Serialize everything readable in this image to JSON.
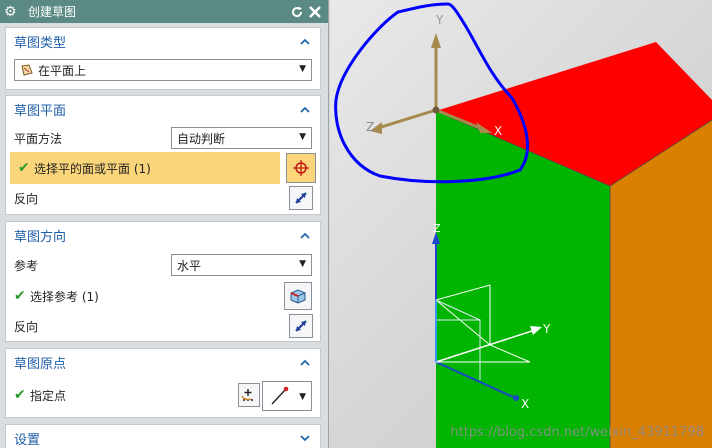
{
  "dialog": {
    "title": "创建草图",
    "icons": {
      "app": "gear-icon",
      "reset": "reset-icon",
      "close": "close-icon"
    }
  },
  "sketch_type": {
    "header": "草图类型",
    "value": "在平面上"
  },
  "sketch_plane": {
    "header": "草图平面",
    "method_label": "平面方法",
    "method_value": "自动判断",
    "select_label": "选择平的面或平面 (1)",
    "reverse_label": "反向"
  },
  "sketch_orientation": {
    "header": "草图方向",
    "reference_label": "参考",
    "reference_value": "水平",
    "select_label": "选择参考 (1)",
    "reverse_label": "反向"
  },
  "sketch_origin": {
    "header": "草图原点",
    "point_label": "指定点"
  },
  "settings": {
    "header": "设置"
  },
  "viewport": {
    "axis_labels": {
      "y_top": "Y",
      "x_top": "X",
      "z_top": "Z",
      "z_bottom": "Z",
      "y_bottom": "Y",
      "x_bottom": "X"
    },
    "watermark": "https://blog.csdn.net/weixin_43911798"
  },
  "colors": {
    "titlebar": "#5a8a83",
    "header_text": "#1f5fa8",
    "highlight_row": "#fbd57a",
    "face_top": "#ff0000",
    "face_front": "#00b400",
    "face_side": "#d98000",
    "annotation": "#0000ff"
  }
}
